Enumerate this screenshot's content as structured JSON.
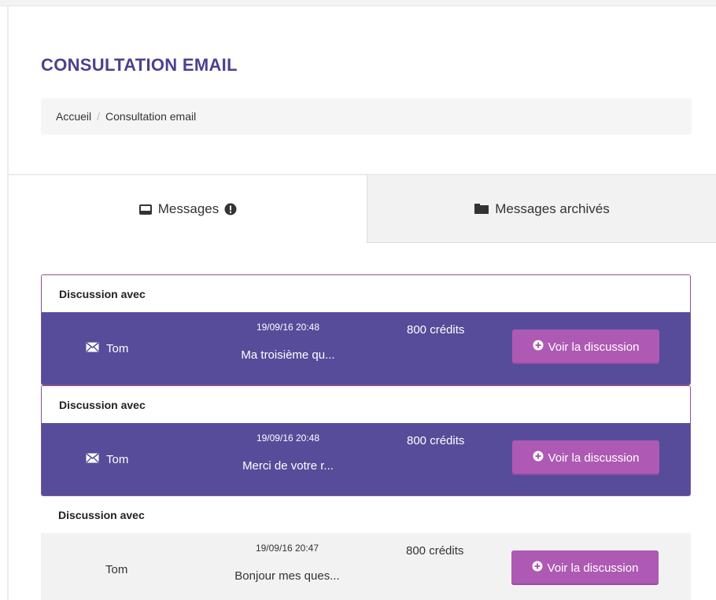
{
  "header": {
    "title": "CONSULTATION EMAIL",
    "breadcrumb": {
      "home": "Accueil",
      "separator": "/",
      "current": "Consultation email"
    }
  },
  "tabs": [
    {
      "label": "Messages",
      "icon": "inbox-icon",
      "badge_icon": "exclamation-circle-icon",
      "active": true
    },
    {
      "label": "Messages archivés",
      "icon": "folder-icon",
      "active": false
    }
  ],
  "discussions": [
    {
      "heading": "Discussion avec",
      "sender": "Tom",
      "unread": true,
      "date": "19/09/16 20:48",
      "preview": "Ma troisième qu...",
      "credits": "800 crédits",
      "button": "Voir la discussion"
    },
    {
      "heading": "Discussion avec",
      "sender": "Tom",
      "unread": true,
      "date": "19/09/16 20:48",
      "preview": "Merci de votre r...",
      "credits": "800 crédits",
      "button": "Voir la discussion"
    },
    {
      "heading": "Discussion avec",
      "sender": "Tom",
      "unread": false,
      "date": "19/09/16 20:47",
      "preview": "Bonjour mes ques...",
      "credits": "800 crédits",
      "button": "Voir la discussion"
    }
  ],
  "colors": {
    "accent": "#564c9a",
    "button": "#ae59b3",
    "title": "#4f3f8f"
  }
}
